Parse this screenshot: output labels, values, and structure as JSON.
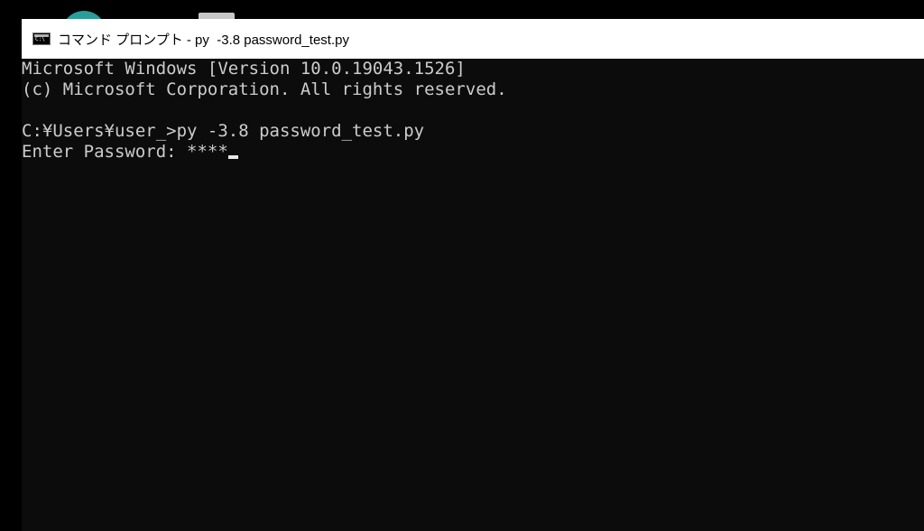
{
  "window": {
    "title": "コマンド プロンプト - py  -3.8 password_test.py"
  },
  "console": {
    "line1": "Microsoft Windows [Version 10.0.19043.1526]",
    "line2": "(c) Microsoft Corporation. All rights reserved.",
    "line3": "",
    "line4": "C:¥Users¥user_>py -3.8 password_test.py",
    "line5": "Enter Password: ****"
  },
  "colors": {
    "console_bg": "#0c0c0c",
    "console_fg": "#cccccc",
    "titlebar_bg": "#ffffff"
  },
  "icons": {
    "app": "cmd-icon",
    "cursor": "text-cursor"
  }
}
